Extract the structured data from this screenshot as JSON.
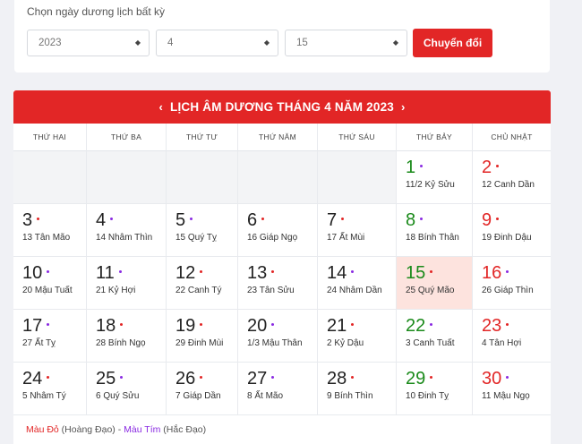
{
  "picker": {
    "title": "Chọn ngày dương lịch bất kỳ",
    "year": "2023",
    "month": "4",
    "day": "15",
    "convert_label": "Chuyển đổi"
  },
  "calendar": {
    "title": "LỊCH ÂM DƯƠNG THÁNG 4 NĂM 2023",
    "prev_icon": "‹",
    "next_icon": "›",
    "weekdays": [
      "THỨ HAI",
      "THỨ BA",
      "THỨ TƯ",
      "THỨ NĂM",
      "THỨ SÁU",
      "THỨ BẢY",
      "CHỦ NHẬT"
    ],
    "leading_blank_cells": 5,
    "today": "15",
    "days": [
      {
        "solar": "1",
        "lunar": "11/2 Kỷ Sửu",
        "dot": "purple"
      },
      {
        "solar": "2",
        "lunar": "12 Canh Dần",
        "dot": "red"
      },
      {
        "solar": "3",
        "lunar": "13 Tân Mão",
        "dot": "red"
      },
      {
        "solar": "4",
        "lunar": "14 Nhâm Thìn",
        "dot": "purple"
      },
      {
        "solar": "5",
        "lunar": "15 Quý Tỵ",
        "dot": "purple"
      },
      {
        "solar": "6",
        "lunar": "16 Giáp Ngọ",
        "dot": "red"
      },
      {
        "solar": "7",
        "lunar": "17 Ất Mùi",
        "dot": "red"
      },
      {
        "solar": "8",
        "lunar": "18 Bính Thân",
        "dot": "purple"
      },
      {
        "solar": "9",
        "lunar": "19 Đinh Dậu",
        "dot": "red"
      },
      {
        "solar": "10",
        "lunar": "20 Mậu Tuất",
        "dot": "purple"
      },
      {
        "solar": "11",
        "lunar": "21 Kỷ Hợi",
        "dot": "purple"
      },
      {
        "solar": "12",
        "lunar": "22 Canh Tý",
        "dot": "red"
      },
      {
        "solar": "13",
        "lunar": "23 Tân Sửu",
        "dot": "red"
      },
      {
        "solar": "14",
        "lunar": "24 Nhâm Dần",
        "dot": "purple"
      },
      {
        "solar": "15",
        "lunar": "25 Quý Mão",
        "dot": "red"
      },
      {
        "solar": "16",
        "lunar": "26 Giáp Thìn",
        "dot": "purple"
      },
      {
        "solar": "17",
        "lunar": "27 Ất Tỵ",
        "dot": "purple"
      },
      {
        "solar": "18",
        "lunar": "28 Bính Ngọ",
        "dot": "red"
      },
      {
        "solar": "19",
        "lunar": "29 Đinh Mùi",
        "dot": "red"
      },
      {
        "solar": "20",
        "lunar": "1/3 Mậu Thân",
        "dot": "purple"
      },
      {
        "solar": "21",
        "lunar": "2 Kỷ Dậu",
        "dot": "red"
      },
      {
        "solar": "22",
        "lunar": "3 Canh Tuất",
        "dot": "purple"
      },
      {
        "solar": "23",
        "lunar": "4 Tân Hợi",
        "dot": "red"
      },
      {
        "solar": "24",
        "lunar": "5 Nhâm Tý",
        "dot": "red"
      },
      {
        "solar": "25",
        "lunar": "6 Quý Sửu",
        "dot": "purple"
      },
      {
        "solar": "26",
        "lunar": "7 Giáp Dần",
        "dot": "red"
      },
      {
        "solar": "27",
        "lunar": "8 Ất Mão",
        "dot": "purple"
      },
      {
        "solar": "28",
        "lunar": "9 Bính Thìn",
        "dot": "red"
      },
      {
        "solar": "29",
        "lunar": "10 Đinh Tỵ",
        "dot": "red"
      },
      {
        "solar": "30",
        "lunar": "11 Mậu Ngọ",
        "dot": "purple"
      }
    ]
  },
  "legend": {
    "red_label": "Màu Đỏ",
    "red_desc": " (Hoàng Đạo) - ",
    "purple_label": "Màu Tím",
    "purple_desc": " (Hắc Đạo)"
  },
  "colors": {
    "accent": "#e22626",
    "saturday": "#1a8a1a",
    "sunday": "#e22626",
    "good_day_dot": "#e22626",
    "bad_day_dot": "#8a2be2",
    "today_bg": "#fde3de"
  }
}
